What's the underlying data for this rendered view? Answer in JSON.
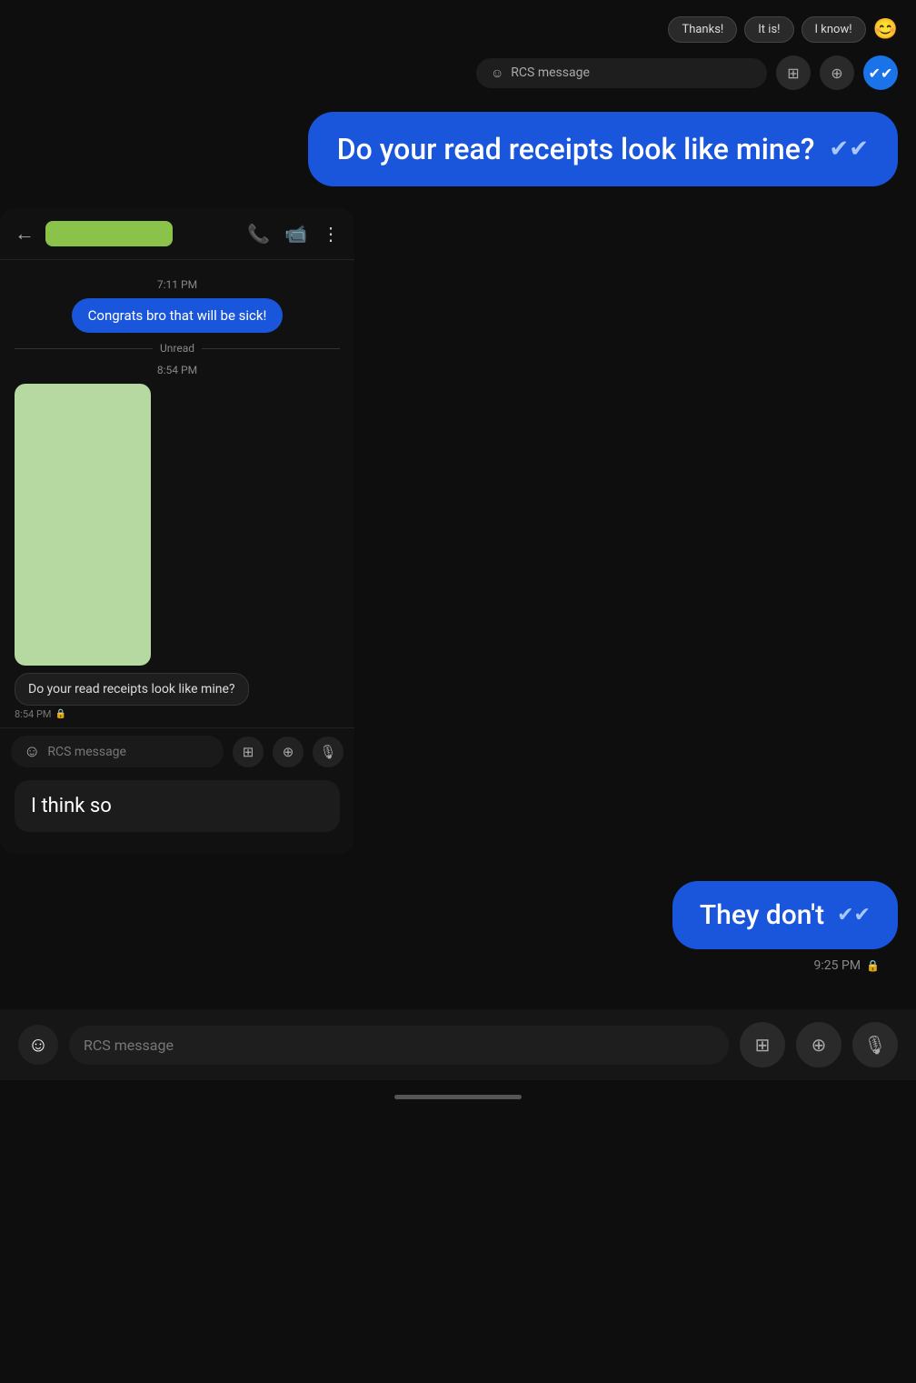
{
  "quickReplies": {
    "chips": [
      "Thanks!",
      "It is!",
      "I know!"
    ],
    "emoji": "😊"
  },
  "topInputBar": {
    "placeholder": "RCS message",
    "icons": [
      "gallery",
      "add-circle",
      "checkmark"
    ]
  },
  "mainBubble": {
    "text": "Do your read receipts look like mine?",
    "checkIcon": "✔✔"
  },
  "chatHeader": {
    "backLabel": "←",
    "callIcon": "📞",
    "videoIcon": "📹",
    "moreIcon": "⋮"
  },
  "messages": {
    "time1": "7:11 PM",
    "bubble1": "Congrats bro that will be sick!",
    "unreadLabel": "Unread",
    "time2": "8:54 PM",
    "outgoingBubble": "Do your read receipts look like mine?",
    "outgoingTime": "8:54 PM",
    "lockIcon": "🔒",
    "innerInputPlaceholder": "RCS message",
    "thinkSoText": "I think so"
  },
  "theyDont": {
    "text": "They don't",
    "checkIcon": "✔✔",
    "time": "9:25 PM",
    "lockIcon": "🔒"
  },
  "bottomBar": {
    "placeholder": "RCS message",
    "emojiIcon": "☺"
  },
  "homeIndicator": {}
}
